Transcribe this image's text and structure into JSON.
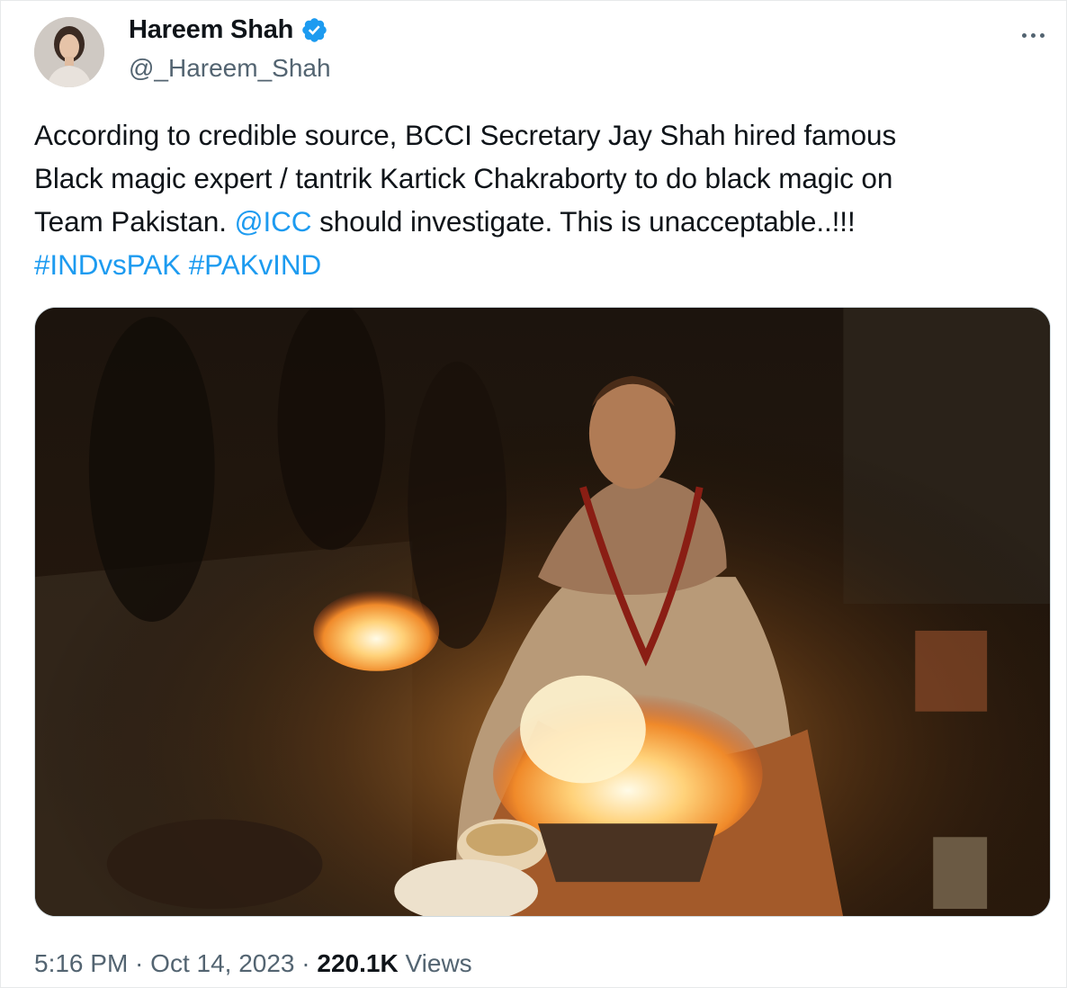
{
  "author": {
    "display_name": "Hareem Shah",
    "handle": "@_Hareem_Shah",
    "verified": true,
    "avatar_icon": "profile-photo"
  },
  "tweet": {
    "line1": "According to credible source, BCCI Secretary Jay Shah hired famous",
    "line2": "Black magic expert / tantrik Kartick Chakraborty to do black magic on",
    "line3_prefix": "Team Pakistan. ",
    "mention": "@ICC",
    "line3_suffix": " should investigate. This is unacceptable..!!!",
    "hashtag1": "#INDvsPAK",
    "hashtag2": "#PAKvIND"
  },
  "media": {
    "description_icon": "photo-fire-ritual"
  },
  "meta": {
    "time": "5:16 PM",
    "separator": " · ",
    "date": "Oct 14, 2023",
    "views_count": "220.1K",
    "views_label": "Views"
  },
  "colors": {
    "link": "#1d9bf0",
    "secondary_text": "#536471",
    "primary_text": "#0f1419",
    "verified_badge": "#1d9bf0"
  }
}
